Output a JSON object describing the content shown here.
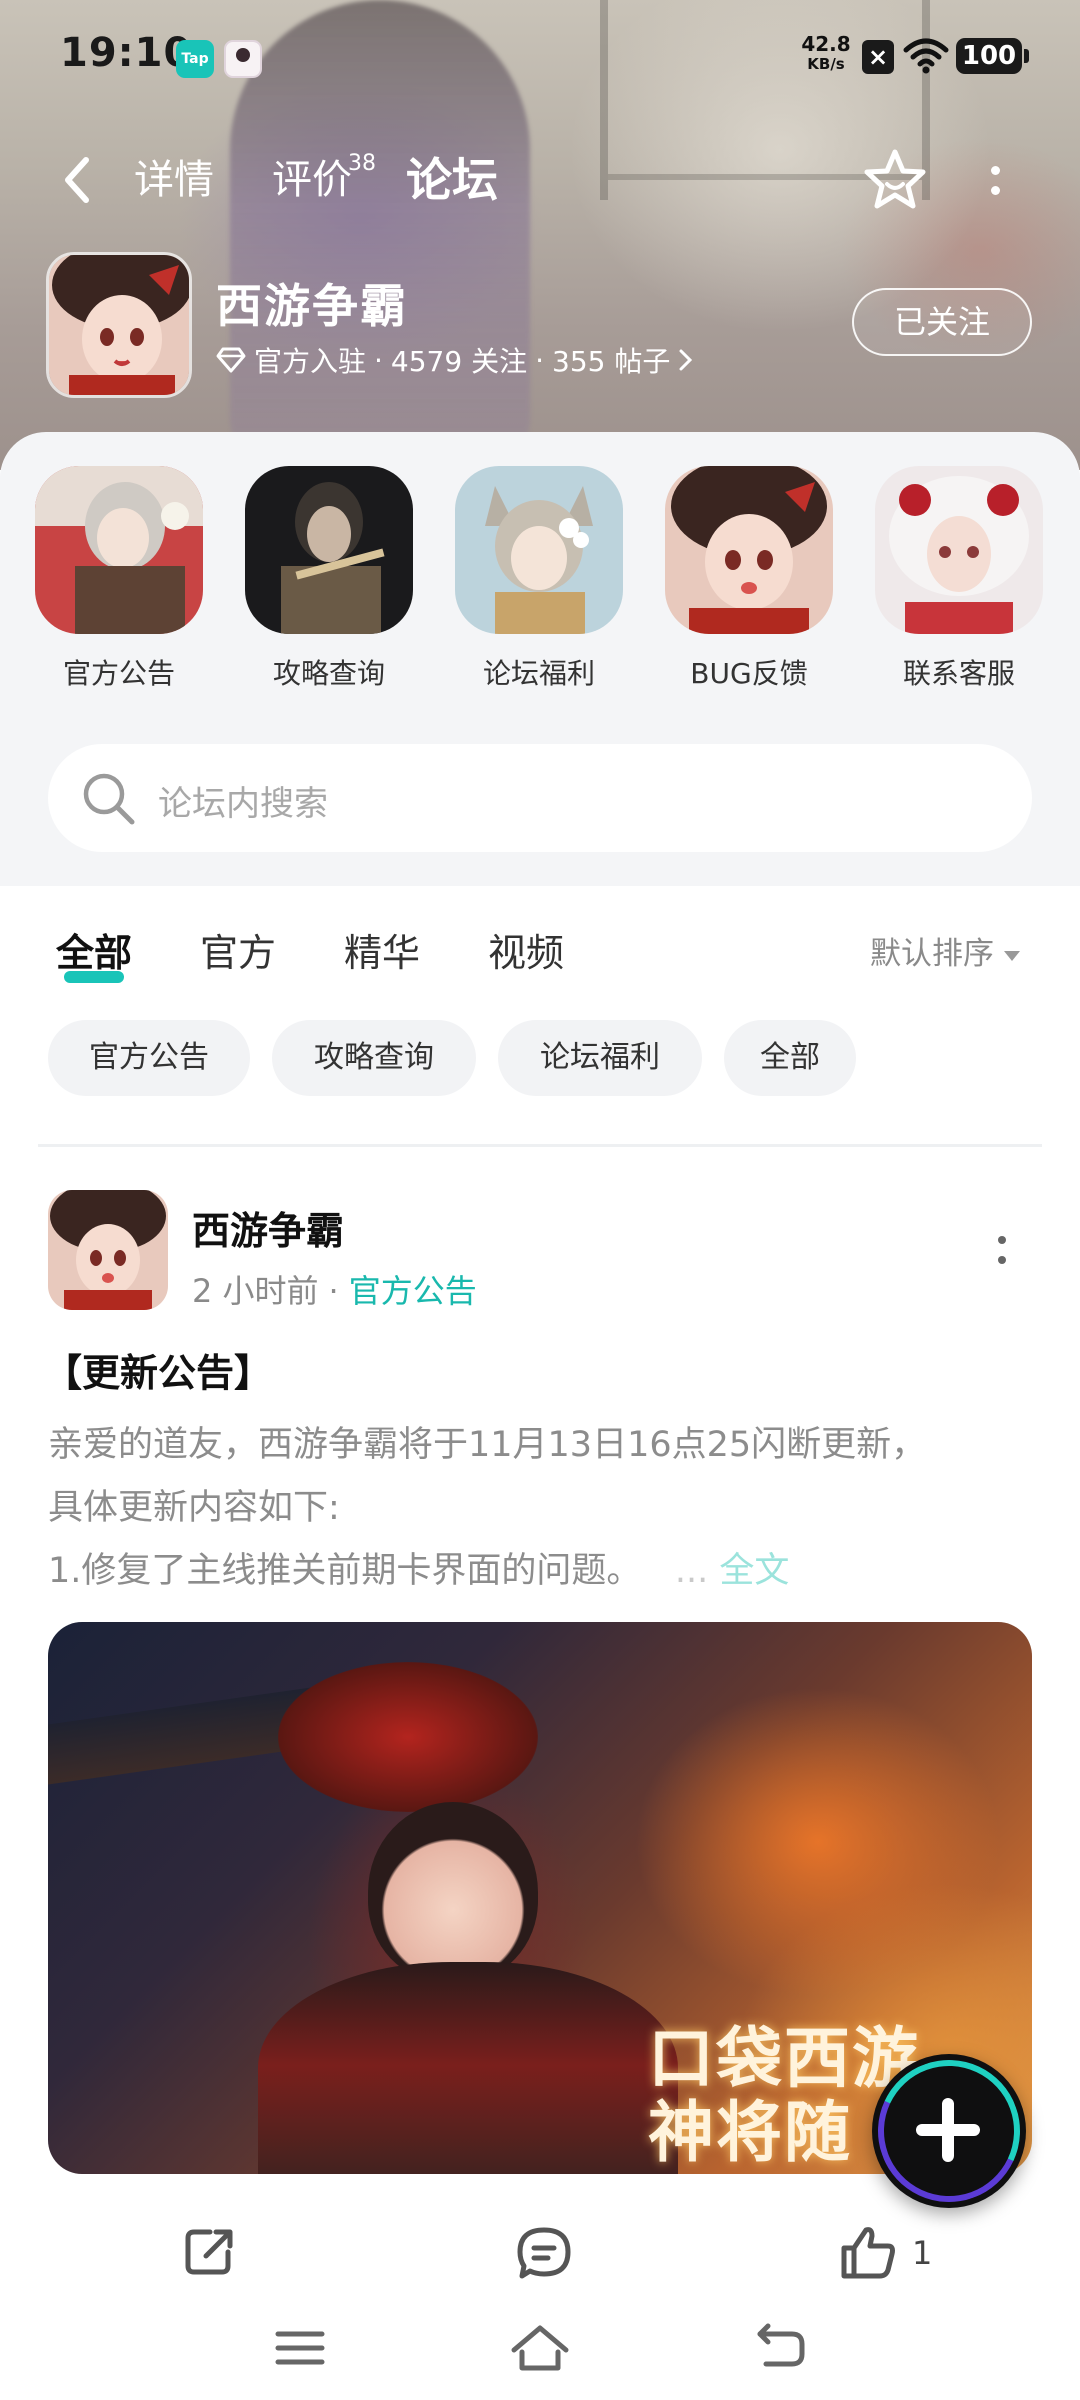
{
  "status_bar": {
    "time": "19:10",
    "app_icon_1": "tap-icon",
    "app_icon_1_text": "Tap",
    "net_speed": "42.8",
    "net_unit": "KB/s",
    "battery": "100"
  },
  "nav": {
    "tabs": [
      {
        "label": "详情"
      },
      {
        "label": "评价",
        "count": "38"
      },
      {
        "label": "论坛",
        "active": true
      }
    ]
  },
  "game": {
    "title": "西游争霸",
    "verified": "官方入驻",
    "followers": "4579 关注",
    "posts": "355 帖子",
    "follow_label": "已关注"
  },
  "categories": [
    {
      "label": "官方公告"
    },
    {
      "label": "攻略查询"
    },
    {
      "label": "论坛福利"
    },
    {
      "label": "BUG反馈"
    },
    {
      "label": "联系客服"
    }
  ],
  "search": {
    "placeholder": "论坛内搜索"
  },
  "filter_tabs": [
    {
      "label": "全部",
      "active": true
    },
    {
      "label": "官方"
    },
    {
      "label": "精华"
    },
    {
      "label": "视频"
    }
  ],
  "sort_label": "默认排序",
  "chips": [
    "官方公告",
    "攻略查询",
    "论坛福利",
    "全部"
  ],
  "post": {
    "author": "西游争霸",
    "time": "2 小时前",
    "category": "官方公告",
    "title": "【更新公告】",
    "body_line1": "亲爱的道友，西游争霸将于11月13日16点25闪断更新，",
    "body_line2": "具体更新内容如下:",
    "body_line3": "1.修复了主线推关前期卡界面的问题。",
    "ellipsis": "...",
    "full_text": "全文",
    "image_watermark_1": "口袋西游",
    "image_watermark_2": "神将随",
    "likes": "1"
  },
  "colors": {
    "accent": "#19c4b8",
    "muted_text": "#8a8a8a"
  }
}
